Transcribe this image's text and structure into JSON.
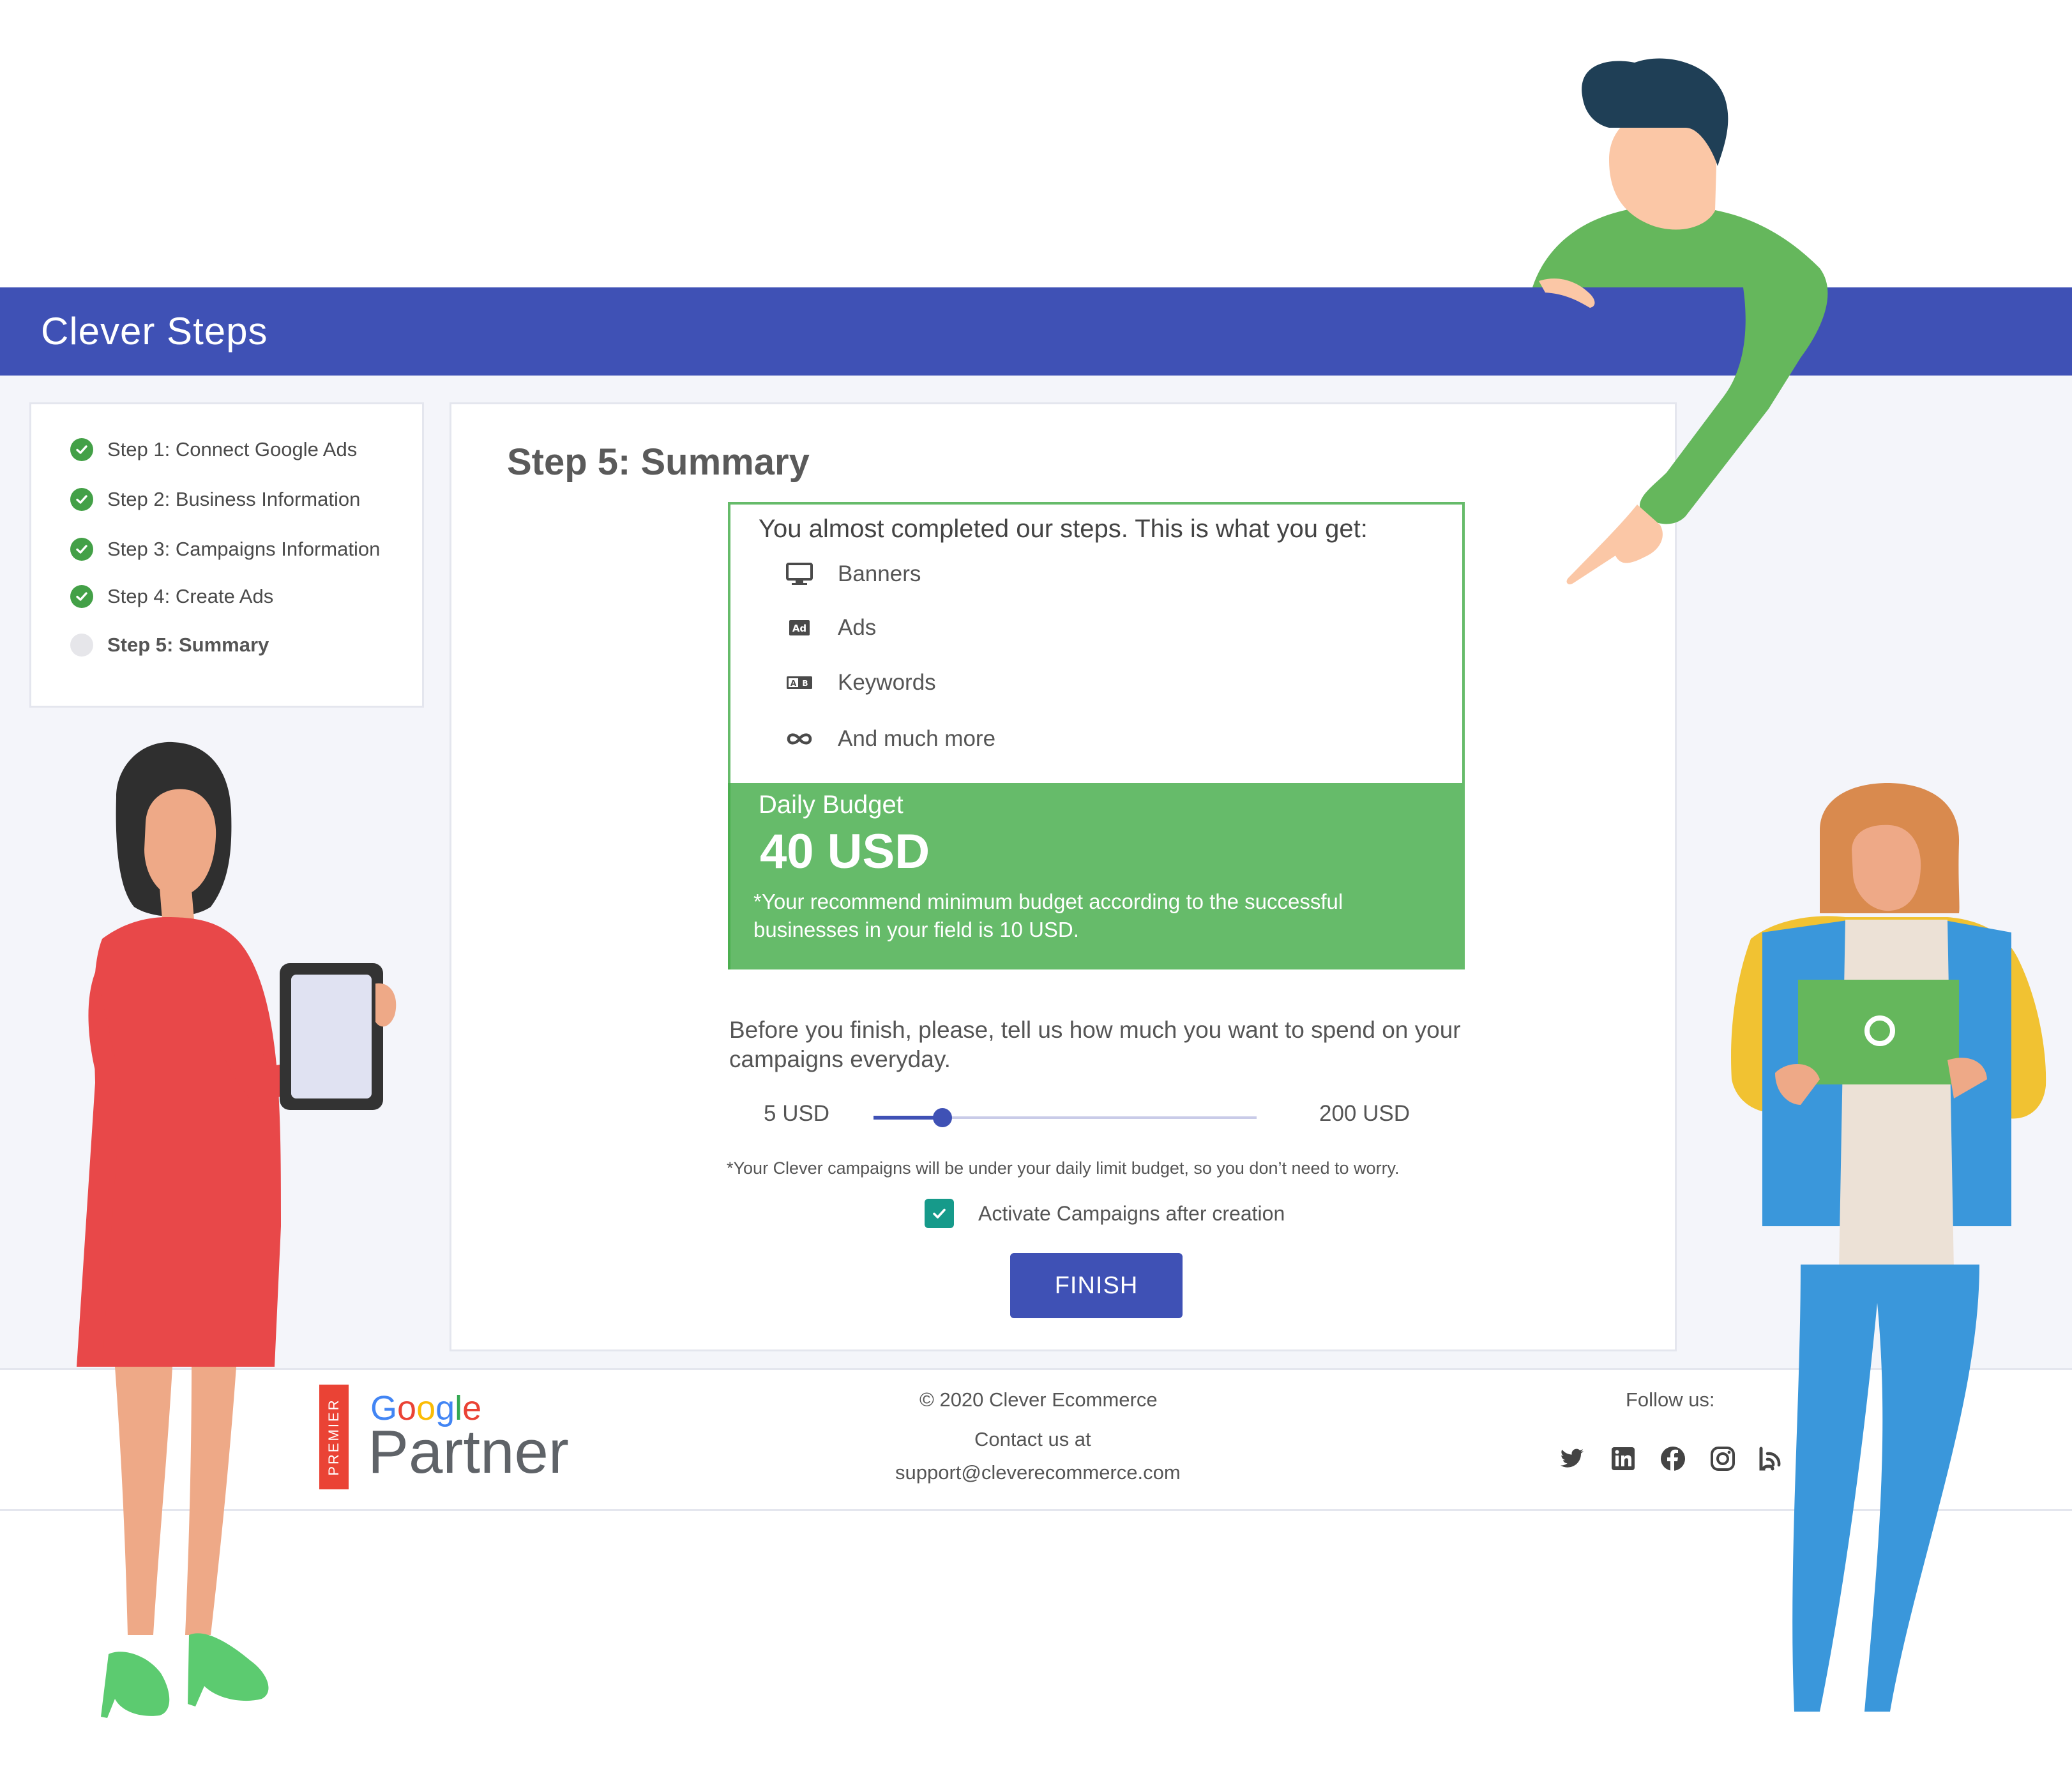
{
  "app": {
    "title": "Clever Steps"
  },
  "steps": [
    {
      "label": "Step 1: Connect Google Ads",
      "status": "done"
    },
    {
      "label": "Step 2: Business Information",
      "status": "done"
    },
    {
      "label": "Step 3: Campaigns Information",
      "status": "done"
    },
    {
      "label": "Step 4: Create Ads",
      "status": "done"
    },
    {
      "label": "Step 5: Summary",
      "status": "current"
    }
  ],
  "summary": {
    "title": "Step 5: Summary",
    "intro": "You almost completed our steps. This is what you get:",
    "features": [
      {
        "icon": "monitor-icon",
        "label": "Banners"
      },
      {
        "icon": "ad-icon",
        "label": "Ads"
      },
      {
        "icon": "keywords-icon",
        "label": "Keywords"
      },
      {
        "icon": "infinity-icon",
        "label": "And much more"
      }
    ]
  },
  "budget": {
    "label": "Daily Budget",
    "value": "40 USD",
    "note": "*Your recommend minimum budget according to the successful businesses in your field is 10 USD."
  },
  "spend": {
    "question": "Before you finish, please, tell us how much you want to spend on your campaigns everyday.",
    "min_label": "5 USD",
    "max_label": "200 USD",
    "slider_min": 5,
    "slider_max": 200,
    "slider_value": 40,
    "note": "*Your Clever campaigns will be under your daily limit budget, so you don’t need to worry."
  },
  "activate": {
    "label": "Activate Campaigns after creation",
    "checked": true
  },
  "finish_label": "FINISH",
  "footer": {
    "copyright": "© 2020 Clever Ecommerce",
    "contact_label": "Contact us at",
    "email": "support@cleverecommerce.com",
    "follow_label": "Follow us:",
    "social": [
      "twitter-icon",
      "linkedin-icon",
      "facebook-icon",
      "instagram-icon",
      "blog-icon"
    ]
  },
  "badge": {
    "premier": "PREMIER",
    "google": "Google",
    "partner": "Partner"
  },
  "colors": {
    "primary": "#3f51b5",
    "success": "#66bb6a",
    "check": "#43a047",
    "teal": "#169a8a",
    "google_blue": "#4285f4",
    "google_red": "#ea4335",
    "google_yellow": "#fbbc05",
    "google_green": "#34a853"
  }
}
